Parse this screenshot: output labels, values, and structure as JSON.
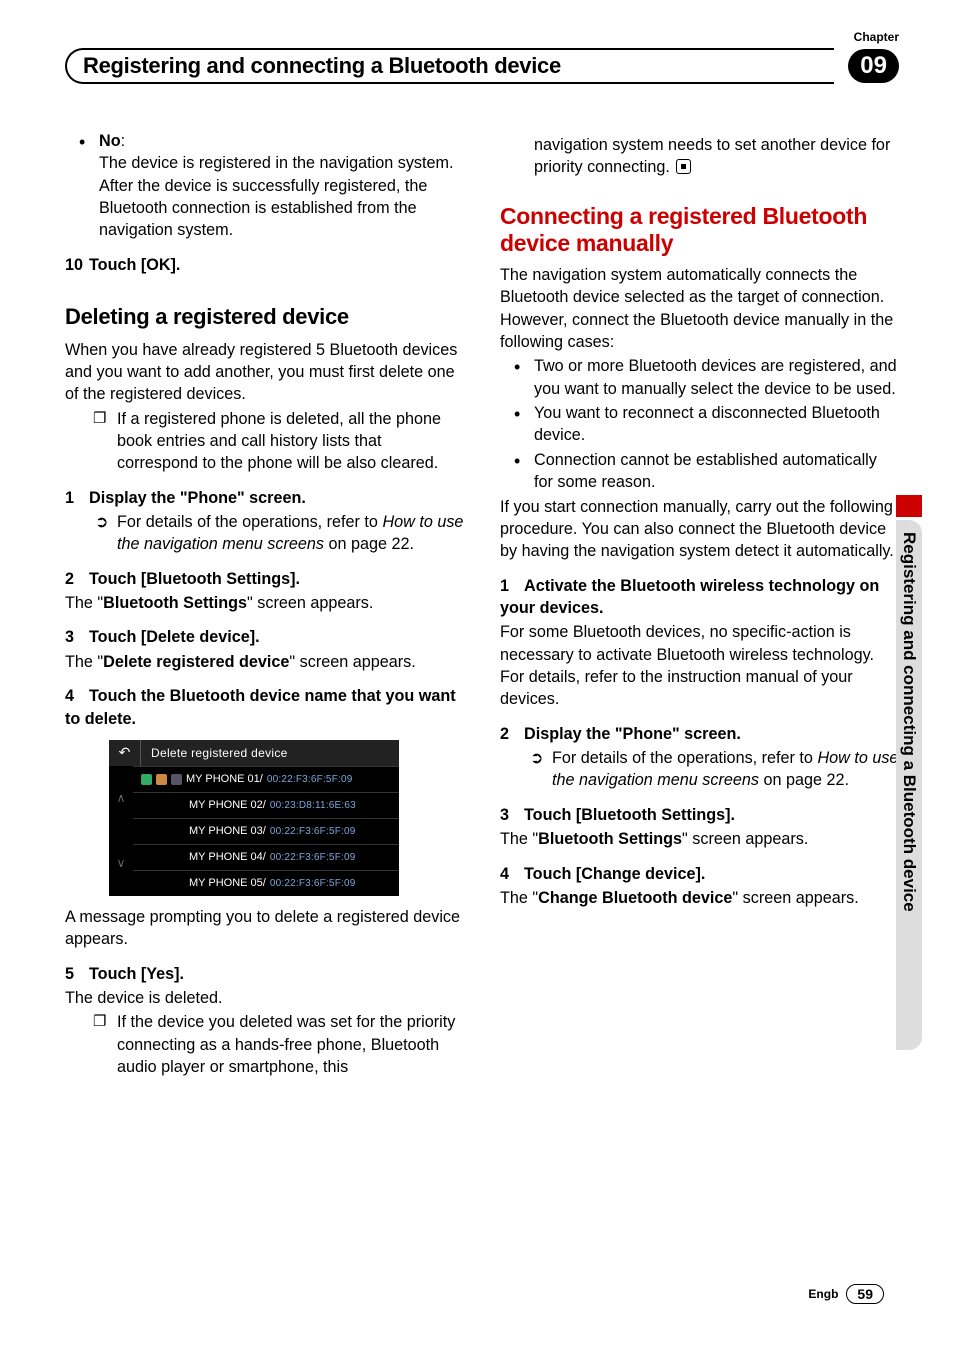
{
  "chapter": {
    "label": "Chapter",
    "num": "09"
  },
  "pageTitle": "Registering and connecting a Bluetooth device",
  "sideTab": "Registering and connecting a Bluetooth device",
  "footer": {
    "lang": "Engb",
    "page": "59"
  },
  "left": {
    "no_label": "No",
    "no_text": "The device is registered in the navigation system. After the device is successfully registered, the Bluetooth connection is established from the navigation system.",
    "step10": "Touch [OK].",
    "h2_delete": "Deleting a registered device",
    "delete_intro": "When you have already registered 5 Bluetooth devices and you want to add another, you must first delete one of the registered devices.",
    "delete_note": "If a registered phone is deleted, all the phone book entries and call history lists that correspond to the phone will be also cleared.",
    "s1": "Display the \"Phone\" screen.",
    "s1_sub_a": "For details of the operations, refer to ",
    "s1_sub_b": "How to use the navigation menu screens",
    "s1_sub_c": " on page 22.",
    "s2": "Touch [Bluetooth Settings].",
    "s2_after_a": "The \"",
    "s2_after_b": "Bluetooth Settings",
    "s2_after_c": "\" screen appears.",
    "s3": "Touch [Delete device].",
    "s3_after_a": "The \"",
    "s3_after_b": "Delete registered device",
    "s3_after_c": "\" screen appears.",
    "s4": "Touch the Bluetooth device name that you want to delete.",
    "screenshot": {
      "title": "Delete registered device",
      "rows": [
        {
          "name": "MY PHONE 01/",
          "addr": "00:22:F3:6F:5F:09",
          "icons": true
        },
        {
          "name": "MY PHONE 02/",
          "addr": "00:23:D8:11:6E:63",
          "icons": false
        },
        {
          "name": "MY PHONE 03/",
          "addr": "00:22:F3:6F:5F:09",
          "icons": false
        },
        {
          "name": "MY PHONE 04/",
          "addr": "00:22:F3:6F:5F:09",
          "icons": false
        },
        {
          "name": "MY PHONE 05/",
          "addr": "00:22:F3:6F:5F:09",
          "icons": false
        }
      ]
    },
    "after_ss": "A message prompting you to delete a registered device appears.",
    "s5": "Touch [Yes].",
    "s5_after": "The device is deleted.",
    "s5_sub": "If the device you deleted was set for the priority connecting as a hands-free phone, Bluetooth audio player or smartphone, this"
  },
  "right": {
    "cont": "navigation system needs to set another device for priority connecting.",
    "h2_connect": "Connecting a registered Bluetooth device manually",
    "connect_intro": "The navigation system automatically connects the Bluetooth device selected as the target of connection. However, connect the Bluetooth device manually in the following cases:",
    "b1": "Two or more Bluetooth devices are registered, and you want to manually select the device to be used.",
    "b2": "You want to reconnect a disconnected Bluetooth device.",
    "b3": "Connection cannot be established automatically for some reason.",
    "after_bullets": "If you start connection manually, carry out the following procedure. You can also connect the Bluetooth device by having the navigation system detect it automatically.",
    "r1": "Activate the Bluetooth wireless technology on your devices.",
    "r1_after": "For some Bluetooth devices, no specific-action is necessary to activate Bluetooth wireless technology. For details, refer to the instruction manual of your devices.",
    "r2": "Display the \"Phone\" screen.",
    "r2_sub_a": "For details of the operations, refer to ",
    "r2_sub_b": "How to use the navigation menu screens",
    "r2_sub_c": " on page 22.",
    "r3": "Touch [Bluetooth Settings].",
    "r3_after_a": "The \"",
    "r3_after_b": "Bluetooth Settings",
    "r3_after_c": "\" screen appears.",
    "r4": "Touch [Change device].",
    "r4_after_a": "The \"",
    "r4_after_b": "Change Bluetooth device",
    "r4_after_c": "\" screen appears."
  }
}
